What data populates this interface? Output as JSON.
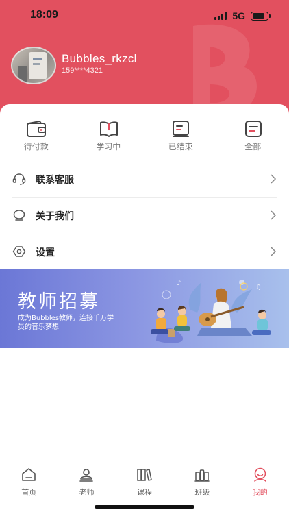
{
  "status_bar": {
    "time": "18:09",
    "network": "5G",
    "battery_level": 0.85
  },
  "profile": {
    "username": "Bubbles_rkzcl",
    "phone": "159****4321"
  },
  "orders": [
    {
      "label": "待付款",
      "icon": "wallet-icon"
    },
    {
      "label": "学习中",
      "icon": "open-book-icon"
    },
    {
      "label": "已结束",
      "icon": "closed-book-icon"
    },
    {
      "label": "全部",
      "icon": "document-list-icon"
    }
  ],
  "menu": [
    {
      "label": "联系客服",
      "icon": "headset-icon"
    },
    {
      "label": "关于我们",
      "icon": "speech-bubble-icon"
    },
    {
      "label": "设置",
      "icon": "settings-icon"
    }
  ],
  "banner": {
    "title": "教师招募",
    "subtitle": "成为Bubbles教师，连接千万学员的音乐梦想"
  },
  "tabs": [
    {
      "label": "首页",
      "icon": "home-icon",
      "active": false
    },
    {
      "label": "老师",
      "icon": "teacher-icon",
      "active": false
    },
    {
      "label": "课程",
      "icon": "books-icon",
      "active": false
    },
    {
      "label": "班级",
      "icon": "class-icon",
      "active": false
    },
    {
      "label": "我的",
      "icon": "profile-icon",
      "active": true
    }
  ],
  "colors": {
    "brand": "#e2505f",
    "banner_start": "#6b77d6",
    "banner_end": "#a8c0ec"
  }
}
